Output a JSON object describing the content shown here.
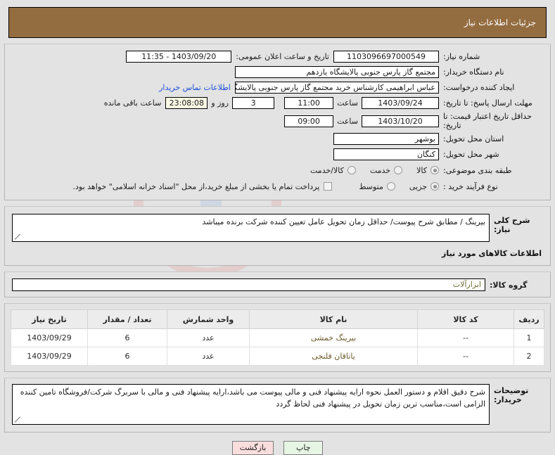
{
  "header": {
    "title": "جزئیات اطلاعات نیاز"
  },
  "form": {
    "need_number_label": "شماره نیاز:",
    "need_number_value": "1103096697000549",
    "publish_label": "تاریخ و ساعت اعلان عمومی:",
    "publish_value": "11:35 - 1403/09/20",
    "buyer_org_label": "نام دستگاه خریدار:",
    "buyer_org_value": "مجتمع گاز پارس جنوبی  پالایشگاه یازدهم",
    "creator_label": "ایجاد کننده درخواست:",
    "creator_value": "عباس ابراهیمی کارشناس خرید مجتمع گاز پارس جنوبی  پالایشگاه یازدهم",
    "contact_link": "اطلاعات تماس خریدار",
    "deadline_label": "مهلت ارسال پاسخ: تا تاریخ:",
    "deadline_date": "1403/09/24",
    "deadline_time_label": "ساعت",
    "deadline_time": "11:00",
    "remaining_days": "3",
    "remaining_days_label": "روز و",
    "remaining_clock": "23:08:08",
    "remaining_text": "ساعت باقی مانده",
    "validity_label": "حداقل تاریخ اعتبار قیمت: تا تاریخ:",
    "validity_date": "1403/10/20",
    "validity_time_label": "ساعت",
    "validity_time": "09:00",
    "province_label": "استان محل تحویل:",
    "province_value": "بوشهر",
    "city_label": "شهر محل تحویل:",
    "city_value": "کنگان",
    "category_label": "طبقه بندی موضوعی:",
    "category_options": [
      {
        "label": "کالا",
        "checked": true
      },
      {
        "label": "خدمت",
        "checked": false
      },
      {
        "label": "کالا/خدمت",
        "checked": false
      }
    ],
    "process_label": "نوع فرآیند خرید :",
    "process_options": [
      {
        "label": "جزیی",
        "checked": true
      },
      {
        "label": "متوسط",
        "checked": false
      }
    ],
    "treasury_checkbox_text": "پرداخت تمام یا بخشی از مبلغ خرید،از محل \"اسناد خزانه اسلامی\" خواهد بود.",
    "treasury_checked": false
  },
  "description": {
    "label": "شرح کلی نیاز:",
    "value": "بیرینگ / مطابق شرح پیوست/ حداقل زمان تحویل عامل تعیین کننده شرکت برنده میباشد"
  },
  "goods_section": {
    "title": "اطلاعات کالاهای مورد نیاز",
    "group_label": "گروه کالا:",
    "group_value": "ابزارآلات"
  },
  "table": {
    "columns": [
      "ردیف",
      "کد کالا",
      "نام کالا",
      "واحد شمارش",
      "تعداد / مقدار",
      "تاریخ نیاز"
    ],
    "rows": [
      {
        "radif": "1",
        "code": "--",
        "name": "بیرینگ خمشی",
        "unit": "عدد",
        "qty": "6",
        "date": "1403/09/29"
      },
      {
        "radif": "2",
        "code": "--",
        "name": "یاتاقان فلنجی",
        "unit": "عدد",
        "qty": "6",
        "date": "1403/09/29"
      }
    ]
  },
  "notes": {
    "label": "توضیحات خریدار:",
    "value": "شرح دقیق اقلام و دستور العمل نحوه ارایه پیشنهاد فنی و مالی پیوست می باشد،ارایه پیشنهاد فنی و مالی با سربرگ شرکت/فروشگاه تامین کننده الزامی است،مناسب ترین زمان تحویل در پیشنهاد فنی لحاظ گردد"
  },
  "buttons": {
    "print": "چاپ",
    "back": "بازگشت"
  },
  "watermark": {
    "text": "iranatender.net"
  },
  "colors": {
    "header_bg": "#936c40",
    "page_bg": "#e3e3e3",
    "link": "#1a4fd6",
    "print_btn": "#e7f5e5",
    "back_btn": "#fadede"
  }
}
